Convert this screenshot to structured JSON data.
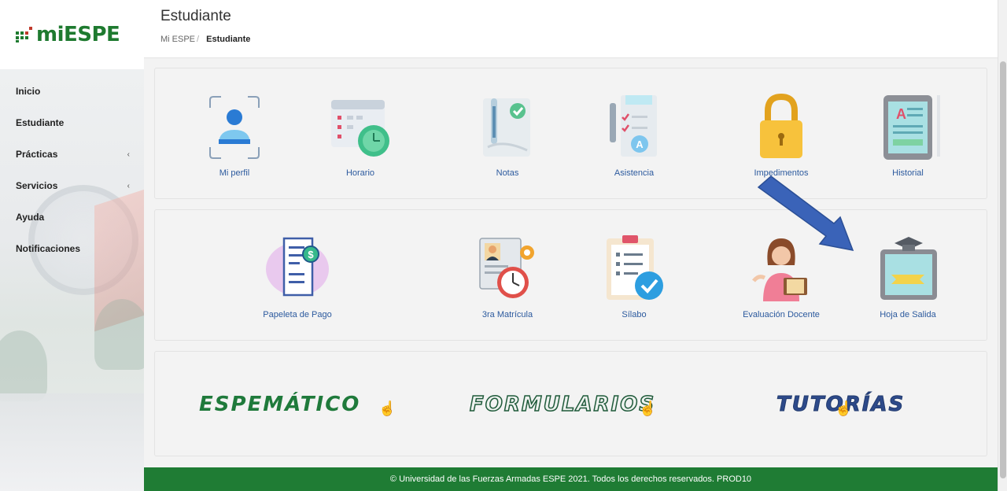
{
  "app": {
    "logo_text": "miESPE",
    "page_title": "Estudiante",
    "breadcrumb": [
      "Mi ESPE",
      "Estudiante"
    ]
  },
  "sidebar": {
    "items": [
      {
        "label": "Inicio",
        "has_submenu": false
      },
      {
        "label": "Estudiante",
        "has_submenu": false
      },
      {
        "label": "Prácticas",
        "has_submenu": true
      },
      {
        "label": "Servicios",
        "has_submenu": true
      },
      {
        "label": "Ayuda",
        "has_submenu": false
      },
      {
        "label": "Notificaciones",
        "has_submenu": false
      }
    ]
  },
  "tiles_row1": [
    {
      "label": "Mi perfil",
      "icon": "profile-icon"
    },
    {
      "label": "Horario",
      "icon": "calendar-clock-icon"
    },
    {
      "label": "Notas",
      "icon": "grades-icon"
    },
    {
      "label": "Asistencia",
      "icon": "attendance-icon"
    },
    {
      "label": "Impedimentos",
      "icon": "lock-icon"
    },
    {
      "label": "Historial",
      "icon": "history-tablet-icon"
    }
  ],
  "tiles_row2": [
    {
      "label": "Papeleta de Pago",
      "icon": "payment-receipt-icon"
    },
    {
      "label": "3ra Matrícula",
      "icon": "enrollment-clock-icon"
    },
    {
      "label": "Sílabo",
      "icon": "syllabus-check-icon"
    },
    {
      "label": "Evaluación Docente",
      "icon": "teacher-evaluation-icon"
    },
    {
      "label": "Hoja de Salida",
      "icon": "graduation-tablet-icon"
    }
  ],
  "brands": [
    "ESPEMÁTICO",
    "FORMULARIOS",
    "TUTORÍAS"
  ],
  "footer": "© Universidad de las Fuerzas Armadas ESPE 2021. Todos los derechos reservados. PROD10",
  "colors": {
    "brand_green": "#1f7c34",
    "link_blue": "#2c5a9e",
    "arrow_blue": "#3a63b8"
  }
}
